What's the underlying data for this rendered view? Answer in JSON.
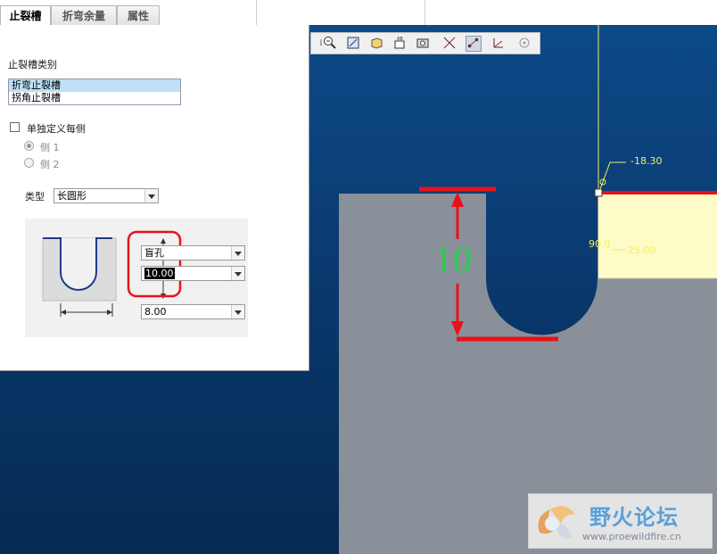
{
  "tabs": [
    {
      "label": "止裂槽",
      "active": true
    },
    {
      "label": "折弯余量",
      "active": false
    },
    {
      "label": "属性",
      "active": false
    }
  ],
  "panel": {
    "relief_category_label": "止裂槽类别",
    "relief_list": [
      "折弯止裂槽",
      "拐角止裂槽"
    ],
    "selected_relief": "折弯止裂槽",
    "define_each_side_label": "单独定义每侧",
    "side1_label": "侧 1",
    "side2_label": "侧 2",
    "type_label": "类型",
    "type_value": "长圆形",
    "depth_option": "盲孔",
    "depth_value": "10.00",
    "width_value": "8.00"
  },
  "canvas": {
    "annotation_big": "10",
    "dim_neg": "-18.30",
    "dim_angle": "90.0",
    "dim_len": "25.00"
  },
  "watermark": {
    "title": "野火论坛",
    "url": "www.proewildfire.cn"
  },
  "colors": {
    "viewport_blue": "#0a3a70",
    "part_gray": "#8a9099",
    "highlight_yellow": "#fdfbc8",
    "annotation_red": "#e8121a",
    "annotation_green": "#22d14a",
    "dimension_yellow": "#f0f060"
  },
  "toolbar_icons": [
    "zoom-out-icon",
    "refit-icon",
    "orient-icon",
    "named-view-icon",
    "layers-icon",
    "datum-planes-icon",
    "datum-axes-icon",
    "datum-points-icon",
    "coord-sys-icon",
    "spin-center-icon"
  ]
}
